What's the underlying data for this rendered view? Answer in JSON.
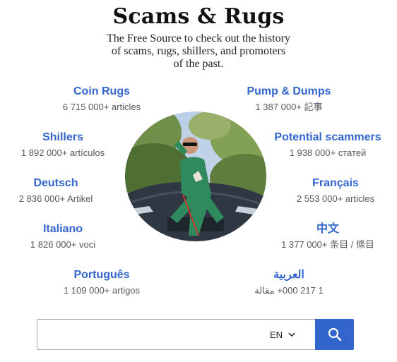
{
  "header": {
    "title": "Scams & Rugs",
    "subtitle_lines": [
      "The Free Source to check out the history",
      "of scams, rugs, shillers, and promoters",
      "of the past."
    ]
  },
  "languages": [
    {
      "name": "Coin Rugs",
      "count": "6 715 000+ articles"
    },
    {
      "name": "Pump & Dumps",
      "count": "1 387 000+ 記事"
    },
    {
      "name": "Shillers",
      "count": "1 892 000+ artículos"
    },
    {
      "name": "Potential scammers",
      "count": "1 938 000+ статей"
    },
    {
      "name": "Deutsch",
      "count": "2 836 000+ Artikel"
    },
    {
      "name": "Français",
      "count": "2 553 000+ articles"
    },
    {
      "name": "Italiano",
      "count": "1 826 000+ voci"
    },
    {
      "name": "中文",
      "count": "1 377 000+ 条目 / 條目"
    },
    {
      "name": "Português",
      "count": "1 109 000+ artigos"
    },
    {
      "name": "العربية",
      "count": "1 217 000+ مقالة"
    }
  ],
  "search": {
    "placeholder": "",
    "language": "EN",
    "search_icon": "magnifier-icon",
    "chevron_icon": "chevron-down-icon"
  },
  "colors": {
    "link": "#3366cc",
    "button": "#3366cc",
    "muted_text": "#54595d"
  }
}
